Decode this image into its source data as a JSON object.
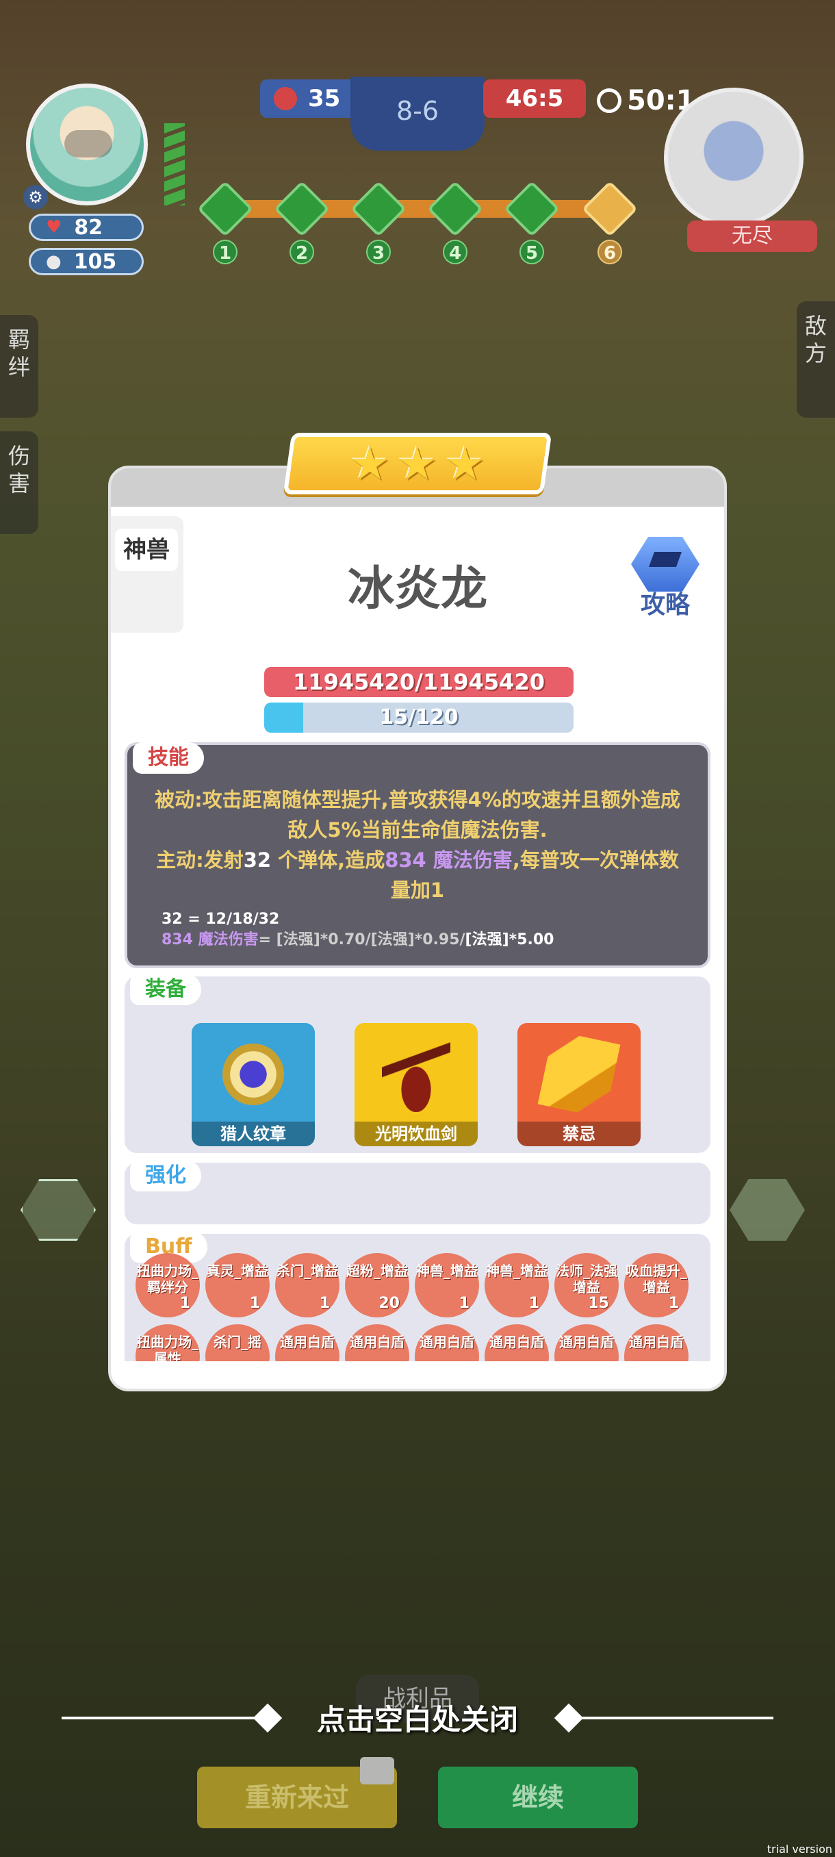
{
  "hud": {
    "player": {
      "hp": "82",
      "coins": "105"
    },
    "score_left": "35",
    "stage": "8-6",
    "score_right": "46:5",
    "timer": "50:1",
    "enemy_label": "无尽",
    "waves": [
      "1",
      "2",
      "3",
      "4",
      "5",
      "6"
    ]
  },
  "side_tabs": {
    "left_1": "羁绊",
    "left_2": "伤害",
    "right": "敌方"
  },
  "dialog": {
    "category_tab": "神兽",
    "hero_name": "冰炎龙",
    "guide_label": "攻略",
    "hp_text": "11945420/11945420",
    "exp_text": "15/120",
    "exp_fraction": 0.125,
    "skill": {
      "tag": "技能",
      "passive": "被动:攻击距离随体型提升,普攻获得4%的攻速并且额外造成敌人5%当前生命值魔法伤害.",
      "active_prefix": "主动:发射",
      "active_num": "32",
      "active_mid": " 个弹体,造成",
      "active_dmg": "834 魔法伤害",
      "active_suffix": ",每普攻一次弹体数量加1",
      "formula_1": "32 = 12/18/32",
      "formula_2_purple": "834 魔法伤害",
      "formula_2_grey": "= [法强]*0.70/[法强]*0.95/",
      "formula_2_white": "[法强]*5.00"
    },
    "equipment": {
      "tag": "装备",
      "items": [
        "猎人纹章",
        "光明饮血剑",
        "禁忌"
      ]
    },
    "strength_tag": "强化",
    "buff_tag": "Buff",
    "buffs": [
      {
        "name": "扭曲力场_羁绊分",
        "count": "1"
      },
      {
        "name": "真灵_增益",
        "count": "1"
      },
      {
        "name": "杀门_增益",
        "count": "1"
      },
      {
        "name": "超粉_增益",
        "count": "20"
      },
      {
        "name": "神兽_增益",
        "count": "1"
      },
      {
        "name": "神兽_增益",
        "count": "1"
      },
      {
        "name": "法师_法强增益",
        "count": "15"
      },
      {
        "name": "吸血提升_增益",
        "count": "1"
      },
      {
        "name": "扭曲力场_属性",
        "count": ""
      },
      {
        "name": "杀门_摇",
        "count": ""
      },
      {
        "name": "通用白盾",
        "count": ""
      },
      {
        "name": "通用白盾",
        "count": ""
      },
      {
        "name": "通用白盾",
        "count": ""
      },
      {
        "name": "通用白盾",
        "count": ""
      },
      {
        "name": "通用白盾",
        "count": ""
      },
      {
        "name": "通用白盾",
        "count": ""
      }
    ]
  },
  "bottom": {
    "close_hint": "点击空白处关闭",
    "loot_tab": "战利品",
    "retry": "重新来过",
    "continue": "继续",
    "trial": "trial version"
  },
  "colors": {
    "hp_red": "#e85e69",
    "exp_blue": "#48c4ef",
    "retry_yellow": "#b8a22a",
    "continue_green": "#23904a"
  }
}
